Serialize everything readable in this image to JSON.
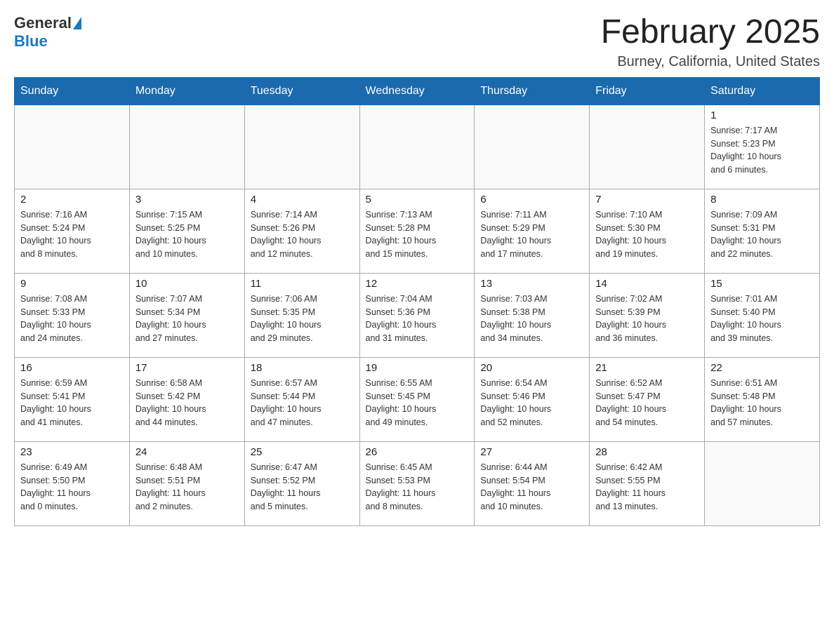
{
  "logo": {
    "general": "General",
    "blue": "Blue"
  },
  "title": "February 2025",
  "location": "Burney, California, United States",
  "weekdays": [
    "Sunday",
    "Monday",
    "Tuesday",
    "Wednesday",
    "Thursday",
    "Friday",
    "Saturday"
  ],
  "weeks": [
    [
      {
        "day": "",
        "info": ""
      },
      {
        "day": "",
        "info": ""
      },
      {
        "day": "",
        "info": ""
      },
      {
        "day": "",
        "info": ""
      },
      {
        "day": "",
        "info": ""
      },
      {
        "day": "",
        "info": ""
      },
      {
        "day": "1",
        "info": "Sunrise: 7:17 AM\nSunset: 5:23 PM\nDaylight: 10 hours\nand 6 minutes."
      }
    ],
    [
      {
        "day": "2",
        "info": "Sunrise: 7:16 AM\nSunset: 5:24 PM\nDaylight: 10 hours\nand 8 minutes."
      },
      {
        "day": "3",
        "info": "Sunrise: 7:15 AM\nSunset: 5:25 PM\nDaylight: 10 hours\nand 10 minutes."
      },
      {
        "day": "4",
        "info": "Sunrise: 7:14 AM\nSunset: 5:26 PM\nDaylight: 10 hours\nand 12 minutes."
      },
      {
        "day": "5",
        "info": "Sunrise: 7:13 AM\nSunset: 5:28 PM\nDaylight: 10 hours\nand 15 minutes."
      },
      {
        "day": "6",
        "info": "Sunrise: 7:11 AM\nSunset: 5:29 PM\nDaylight: 10 hours\nand 17 minutes."
      },
      {
        "day": "7",
        "info": "Sunrise: 7:10 AM\nSunset: 5:30 PM\nDaylight: 10 hours\nand 19 minutes."
      },
      {
        "day": "8",
        "info": "Sunrise: 7:09 AM\nSunset: 5:31 PM\nDaylight: 10 hours\nand 22 minutes."
      }
    ],
    [
      {
        "day": "9",
        "info": "Sunrise: 7:08 AM\nSunset: 5:33 PM\nDaylight: 10 hours\nand 24 minutes."
      },
      {
        "day": "10",
        "info": "Sunrise: 7:07 AM\nSunset: 5:34 PM\nDaylight: 10 hours\nand 27 minutes."
      },
      {
        "day": "11",
        "info": "Sunrise: 7:06 AM\nSunset: 5:35 PM\nDaylight: 10 hours\nand 29 minutes."
      },
      {
        "day": "12",
        "info": "Sunrise: 7:04 AM\nSunset: 5:36 PM\nDaylight: 10 hours\nand 31 minutes."
      },
      {
        "day": "13",
        "info": "Sunrise: 7:03 AM\nSunset: 5:38 PM\nDaylight: 10 hours\nand 34 minutes."
      },
      {
        "day": "14",
        "info": "Sunrise: 7:02 AM\nSunset: 5:39 PM\nDaylight: 10 hours\nand 36 minutes."
      },
      {
        "day": "15",
        "info": "Sunrise: 7:01 AM\nSunset: 5:40 PM\nDaylight: 10 hours\nand 39 minutes."
      }
    ],
    [
      {
        "day": "16",
        "info": "Sunrise: 6:59 AM\nSunset: 5:41 PM\nDaylight: 10 hours\nand 41 minutes."
      },
      {
        "day": "17",
        "info": "Sunrise: 6:58 AM\nSunset: 5:42 PM\nDaylight: 10 hours\nand 44 minutes."
      },
      {
        "day": "18",
        "info": "Sunrise: 6:57 AM\nSunset: 5:44 PM\nDaylight: 10 hours\nand 47 minutes."
      },
      {
        "day": "19",
        "info": "Sunrise: 6:55 AM\nSunset: 5:45 PM\nDaylight: 10 hours\nand 49 minutes."
      },
      {
        "day": "20",
        "info": "Sunrise: 6:54 AM\nSunset: 5:46 PM\nDaylight: 10 hours\nand 52 minutes."
      },
      {
        "day": "21",
        "info": "Sunrise: 6:52 AM\nSunset: 5:47 PM\nDaylight: 10 hours\nand 54 minutes."
      },
      {
        "day": "22",
        "info": "Sunrise: 6:51 AM\nSunset: 5:48 PM\nDaylight: 10 hours\nand 57 minutes."
      }
    ],
    [
      {
        "day": "23",
        "info": "Sunrise: 6:49 AM\nSunset: 5:50 PM\nDaylight: 11 hours\nand 0 minutes."
      },
      {
        "day": "24",
        "info": "Sunrise: 6:48 AM\nSunset: 5:51 PM\nDaylight: 11 hours\nand 2 minutes."
      },
      {
        "day": "25",
        "info": "Sunrise: 6:47 AM\nSunset: 5:52 PM\nDaylight: 11 hours\nand 5 minutes."
      },
      {
        "day": "26",
        "info": "Sunrise: 6:45 AM\nSunset: 5:53 PM\nDaylight: 11 hours\nand 8 minutes."
      },
      {
        "day": "27",
        "info": "Sunrise: 6:44 AM\nSunset: 5:54 PM\nDaylight: 11 hours\nand 10 minutes."
      },
      {
        "day": "28",
        "info": "Sunrise: 6:42 AM\nSunset: 5:55 PM\nDaylight: 11 hours\nand 13 minutes."
      },
      {
        "day": "",
        "info": ""
      }
    ]
  ]
}
